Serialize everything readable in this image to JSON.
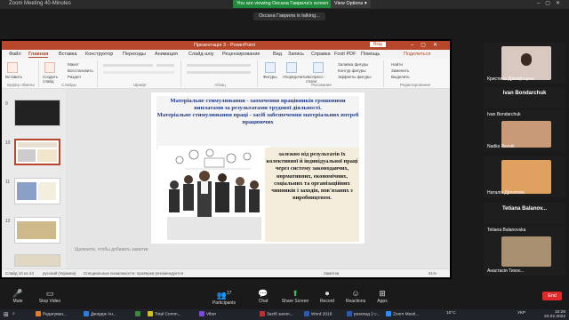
{
  "zoom": {
    "window_title": "Zoom Meeting 40-Minutes",
    "share_banner": "You are viewing Оксана Гаврила's screen",
    "view_options": "View Options ▾",
    "talking": "Оксана Гаврила is talking..."
  },
  "ppt": {
    "doc_title": "Презентація 3 - PowerPoint",
    "signin": "Вхід",
    "tabs": [
      "Файл",
      "Главная",
      "Вставка",
      "Конструктор",
      "Переходы",
      "Анимация",
      "Слайд-шоу",
      "Рецензирование",
      "Вид",
      "Запись",
      "Справка",
      "Foxit PDF",
      "Помощь",
      "Поделиться"
    ],
    "active_tab": "Главная",
    "ribbon_groups": [
      "Буфер обмена",
      "Слайды",
      "Шрифт",
      "Абзац",
      "Рисование",
      "Редактирование"
    ],
    "ribbon_buttons": [
      "Вставить",
      "Создать слайд",
      "Макет",
      "Восстановить",
      "Раздел",
      "Фигуры",
      "Упорядочить",
      "Экспресс-стили",
      "Заливка фигуры",
      "Контур фигуры",
      "Эффекты фигуры",
      "Найти",
      "Заменить",
      "Выделить"
    ],
    "thumb_numbers": [
      "9",
      "10",
      "11",
      "12"
    ],
    "slide": {
      "head_line1": "Матеріальне стимулювання - заохочення працівників грошовими виплатами за результатами трудової діяльності.",
      "head_line2": "Матеріальне стимулювання праці - засіб забезпечення матеріальних потреб працюючих",
      "body": "залежно від результатів їх колективної й індивідуальної праці через систему законодавчих, нормативних, економічних, соціальних та організаційних чинників і заходів, пов'язаних з виробництвом."
    },
    "notes_placeholder": "Щелкните, чтобы добавить заметки",
    "status_slide": "Слайд 10 из 24",
    "status_lang": "русский (Украина)",
    "status_access": "Специальные возможности: проверка рекомендуется",
    "status_notes": "Заметки",
    "status_zoom": "61%"
  },
  "participants": [
    {
      "name": "Кристина Дрімарецька",
      "color": "#d8c8c0"
    },
    {
      "name": "Ivan Bondarchuk",
      "big": "Ivan Bondarchuk",
      "color": ""
    },
    {
      "name": "Nadiia Rezvik",
      "color": "#c89a78"
    },
    {
      "name": "Наталія Дрозлова",
      "color": "#e0a060"
    },
    {
      "name": "Tetiana Balanovska",
      "big": "Tetiana  Balanov...",
      "color": ""
    },
    {
      "name": "Анастасія Тихоє...",
      "color": "#a89070"
    }
  ],
  "toolbar": {
    "mute": "Mute",
    "stop_video": "Stop Video",
    "participants": "Participants",
    "participants_count": "17",
    "chat": "Chat",
    "share": "Share Screen",
    "record": "Record",
    "reactions": "Reactions",
    "apps": "Apps",
    "end": "End"
  },
  "taskbar": {
    "items": [
      "Редагуван...",
      "Джордж Ан...",
      "",
      "Total Comm...",
      "Viber",
      "",
      "Засіб захоп...",
      "",
      "Word 2016",
      "розклад 2 с...",
      "",
      "Zoom Meeti..."
    ],
    "temp": "10°C",
    "lang": "УКР",
    "time": "10:26",
    "date": "23.02.2022"
  }
}
